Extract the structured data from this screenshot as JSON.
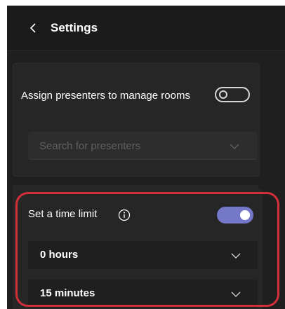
{
  "header": {
    "title": "Settings",
    "back_icon": "chevron-left-icon"
  },
  "presenters": {
    "label": "Assign presenters to manage rooms",
    "toggle_on": false,
    "search_placeholder": "Search for presenters",
    "search_value": ""
  },
  "time_limit": {
    "label": "Set a time limit",
    "info_icon": "info-icon",
    "toggle_on": true,
    "hours_value": "0 hours",
    "minutes_value": "15 minutes"
  },
  "colors": {
    "panel_bg": "#1f1f1f",
    "card_bg": "#262626",
    "toggle_accent": "#7577c9",
    "highlight": "#d32f3b"
  }
}
